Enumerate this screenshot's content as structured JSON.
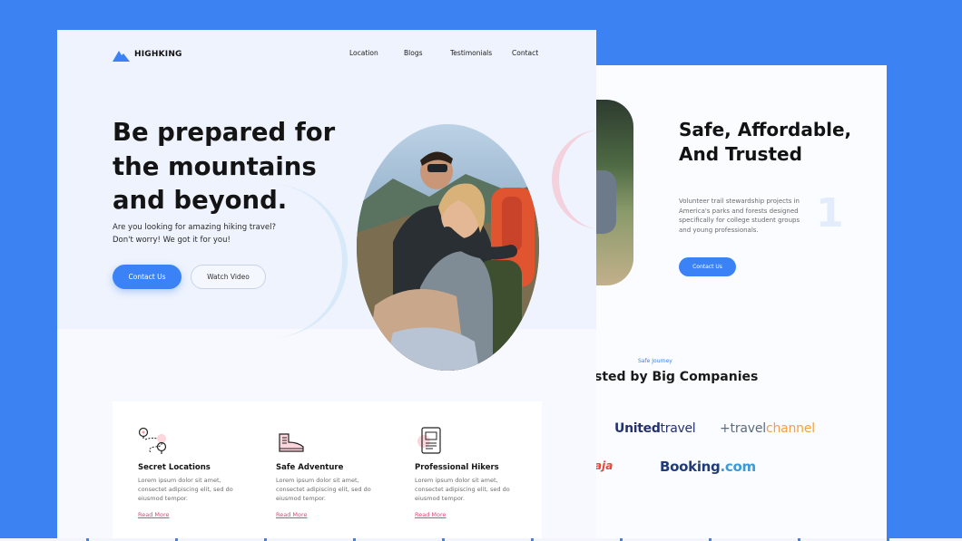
{
  "colors": {
    "background": "#3d82f2",
    "accent": "#3b82f6",
    "link": "#e0457b"
  },
  "brand": {
    "name": "HIGHKING",
    "icon": "mountain-logo-icon"
  },
  "nav": {
    "items": [
      "Location",
      "Blogs",
      "Testimonials",
      "Contact"
    ]
  },
  "hero": {
    "title": "Be prepared for the mountains and beyond.",
    "subtitle": "Are you looking for amazing hiking travel? Don't worry! We got it for you!",
    "primary_button": "Contact Us",
    "secondary_button": "Watch Video",
    "photo": "hikers-couple-with-binoculars-image"
  },
  "features": [
    {
      "icon": "map-route-icon",
      "title": "Secret Locations",
      "text": "Lorem ipsum dolor sit amet, consectet adipiscing elit, sed do eiusmod tempor.",
      "link": "Read More"
    },
    {
      "icon": "hiking-boot-icon",
      "title": "Safe Adventure",
      "text": "Lorem ipsum dolor sit amet, consectet adipiscing elit, sed do eiusmod tempor.",
      "link": "Read More"
    },
    {
      "icon": "id-badge-icon",
      "title": "Professional Hikers",
      "text": "Lorem ipsum dolor sit amet, consectet adipiscing elit, sed do eiusmod tempor.",
      "link": "Read More"
    }
  ],
  "about": {
    "headline": "Safe, Affordable, And Trusted",
    "description": "Volunteer trail stewardship projects in America's parks and forests designed specifically for college student groups and young professionals.",
    "button": "Contact Us",
    "numeral": "1"
  },
  "partners": {
    "eyebrow": "Safe Journey",
    "heading": "sted by Big Companies",
    "logos": {
      "united_bold": "United",
      "united_light": "travel",
      "travel_prefix": "+",
      "travel_a": "travel",
      "travel_b": "channel",
      "aja": "aja",
      "booking": "Booking",
      "booking_com": ".com"
    }
  }
}
